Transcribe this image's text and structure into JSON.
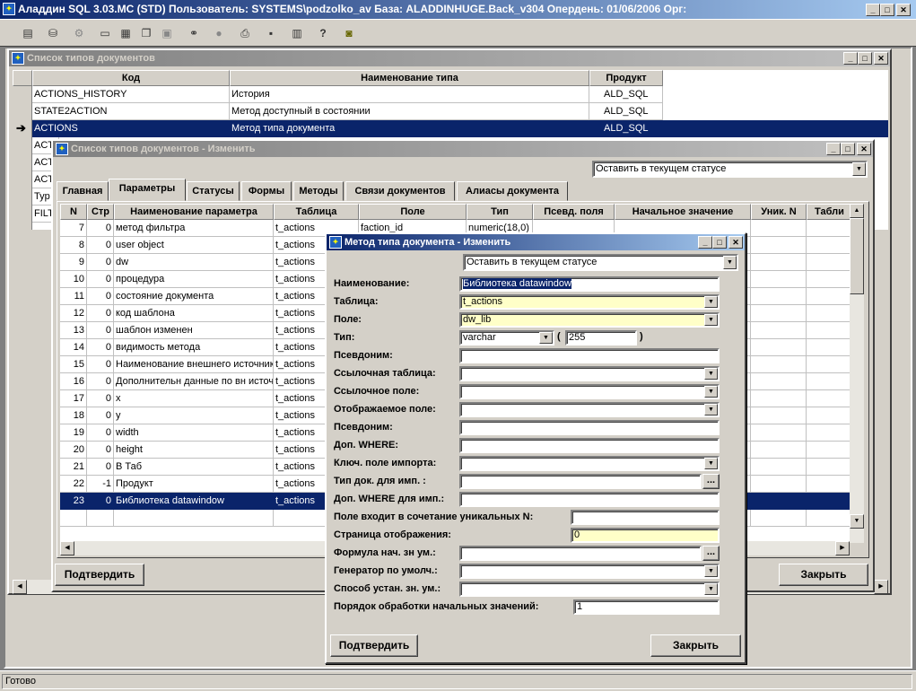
{
  "app": {
    "title": "Аладдин SQL 3.03.MC (STD)  Пользователь: SYSTEMS\\podzolko_av База: ALADDINHUGE.Back_v304 Опердень: 01/06/2006 Орг:",
    "status": "Готово"
  },
  "toolbar": {
    "icons": [
      "document-icon",
      "database-icon",
      "tools-icon",
      "window-icon",
      "tile-icon",
      "cascade-icon",
      "arrange-icon",
      "binoculars-icon",
      "stamp-icon",
      "printer-icon",
      "save-icon",
      "calendar-icon",
      "help-icon",
      "exit-icon"
    ]
  },
  "win1": {
    "title": "Список типов документов",
    "columns": [
      "Код",
      "Наименование типа",
      "Продукт"
    ],
    "rows": [
      {
        "code": "ACTIONS_HISTORY",
        "name": "История",
        "product": "ALD_SQL"
      },
      {
        "code": "STATE2ACTION",
        "name": "Метод доступный в состоянии",
        "product": "ALD_SQL"
      },
      {
        "code": "ACTIONS",
        "name": "Метод типа документа",
        "product": "ALD_SQL"
      }
    ],
    "partial_rows": [
      "ACT",
      "ACT",
      "ACT",
      "Typ",
      "FILT"
    ]
  },
  "win2": {
    "title": "Список типов документов - Изменить",
    "status_select": "Оставить в текущем статусе",
    "tabs": [
      "Главная",
      "Параметры",
      "Статусы",
      "Формы",
      "Методы",
      "Связи документов",
      "Алиасы документа"
    ],
    "columns": [
      "N",
      "Стр",
      "Наименование параметра",
      "Таблица",
      "Поле",
      "Тип",
      "Псевд. поля",
      "Начальное значение",
      "Уник. N",
      "Табли"
    ],
    "first_row": {
      "field": "faction_id",
      "type": "numeric(18,0)"
    },
    "rows": [
      {
        "n": "7",
        "str": "0",
        "name": "метод фильтра",
        "table": "t_actions"
      },
      {
        "n": "8",
        "str": "0",
        "name": "user object",
        "table": "t_actions"
      },
      {
        "n": "9",
        "str": "0",
        "name": "dw",
        "table": "t_actions"
      },
      {
        "n": "10",
        "str": "0",
        "name": "процедура",
        "table": "t_actions"
      },
      {
        "n": "11",
        "str": "0",
        "name": "состояние документа",
        "table": "t_actions"
      },
      {
        "n": "12",
        "str": "0",
        "name": "код шаблона",
        "table": "t_actions"
      },
      {
        "n": "13",
        "str": "0",
        "name": "шаблон изменен",
        "table": "t_actions"
      },
      {
        "n": "14",
        "str": "0",
        "name": "видимость метода",
        "table": "t_actions"
      },
      {
        "n": "15",
        "str": "0",
        "name": "Наименование внешнего источника",
        "table": "t_actions"
      },
      {
        "n": "16",
        "str": "0",
        "name": "Дополнительн данные по вн источ",
        "table": "t_actions"
      },
      {
        "n": "17",
        "str": "0",
        "name": "x",
        "table": "t_actions"
      },
      {
        "n": "18",
        "str": "0",
        "name": "y",
        "table": "t_actions"
      },
      {
        "n": "19",
        "str": "0",
        "name": "width",
        "table": "t_actions"
      },
      {
        "n": "20",
        "str": "0",
        "name": "height",
        "table": "t_actions"
      },
      {
        "n": "21",
        "str": "0",
        "name": "В Таб",
        "table": "t_actions"
      },
      {
        "n": "22",
        "str": "-1",
        "name": "Продукт",
        "table": "t_actions"
      },
      {
        "n": "23",
        "str": "0",
        "name": "Библиотека datawindow",
        "table": "t_actions"
      }
    ],
    "confirm": "Подтвердить",
    "close": "Закрыть"
  },
  "dlg": {
    "title": "Метод типа документа - Изменить",
    "status_select": "Оставить в текущем статусе",
    "labels": {
      "name": "Наименование:",
      "table": "Таблица:",
      "field": "Поле:",
      "type": "Тип:",
      "alias": "Псевдоним:",
      "ref_table": "Ссылочная таблица:",
      "ref_field": "Ссылочное поле:",
      "display_field": "Отображаемое поле:",
      "alias2": "Псевдоним:",
      "where": "Доп. WHERE:",
      "import_key": "Ключ. поле импорта:",
      "import_doc": "Тип док. для имп. :",
      "import_where": "Доп. WHERE для имп.:",
      "unique": "Поле входит в сочетание уникальных N:",
      "page": "Страница отображения:",
      "formula": "Формула нач. зн ум.:",
      "generator": "Генератор по умолч.:",
      "method": "Способ устан. зн. ум.:",
      "order": "Порядок обработки начальных значений:"
    },
    "values": {
      "name": "Библиотека datawindow",
      "table": "t_actions",
      "field": "dw_lib",
      "type": "varchar",
      "type_open": "(",
      "length": "255",
      "type_close": ")",
      "page": "0",
      "order": "1"
    },
    "confirm": "Подтвердить",
    "close": "Закрыть"
  }
}
